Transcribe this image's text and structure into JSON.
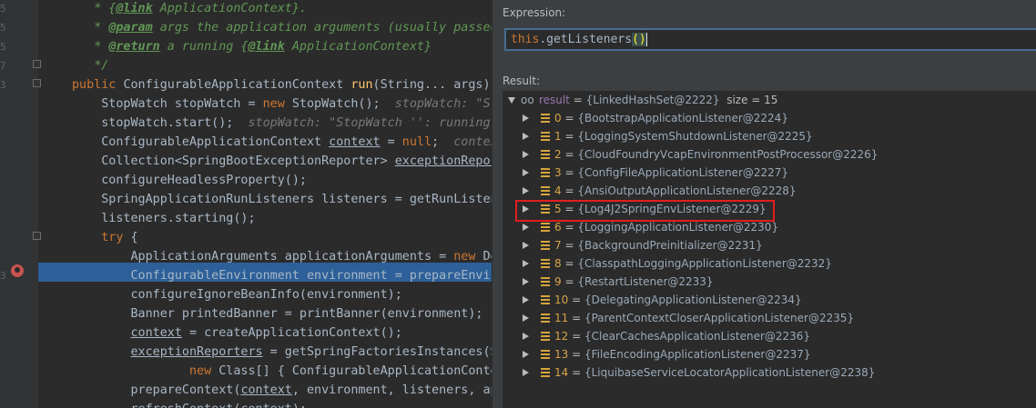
{
  "editor": {
    "line_numbers": [
      "5",
      "5",
      "5",
      "7",
      "3",
      "",
      "",
      "",
      "",
      "",
      "",
      "",
      "",
      "",
      "3",
      "",
      "",
      "",
      "",
      "",
      "",
      ""
    ],
    "lines": [
      {
        "indent": "   ",
        "parts": [
          [
            "cm",
            "* {"
          ],
          [
            "tg",
            "@link"
          ],
          [
            "cm",
            " ApplicationContext}."
          ]
        ]
      },
      {
        "indent": "   ",
        "parts": [
          [
            "cm",
            "* "
          ],
          [
            "tg",
            "@param"
          ],
          [
            "cm",
            " args the application arguments (usually passed f"
          ]
        ]
      },
      {
        "indent": "   ",
        "parts": [
          [
            "cm",
            "* "
          ],
          [
            "tg",
            "@return"
          ],
          [
            "cm",
            " a running {"
          ],
          [
            "tg",
            "@link"
          ],
          [
            "cm",
            " ApplicationContext}"
          ]
        ]
      },
      {
        "indent": "   ",
        "parts": [
          [
            "cm",
            "*/"
          ]
        ]
      },
      {
        "indent": "",
        "parts": [
          [
            "kw",
            "public "
          ],
          [
            "",
            "ConfigurableApplicationContext "
          ],
          [
            "fn",
            "run"
          ],
          [
            "",
            "(String... args) "
          ]
        ]
      },
      {
        "indent": "    ",
        "parts": [
          [
            "",
            "StopWatch stopWatch = "
          ],
          [
            "kw",
            "new "
          ],
          [
            "",
            "StopWatch();  "
          ],
          [
            "hn",
            "stopWatch: \"St"
          ]
        ]
      },
      {
        "indent": "    ",
        "parts": [
          [
            "",
            "stopWatch.start();  "
          ],
          [
            "hn",
            "stopWatch: \"StopWatch '': running"
          ]
        ]
      },
      {
        "indent": "    ",
        "parts": [
          [
            "",
            "ConfigurableApplicationContext "
          ],
          [
            "ul",
            "context"
          ],
          [
            "",
            " = "
          ],
          [
            "kw",
            "null"
          ],
          [
            "",
            ";  "
          ],
          [
            "hn",
            "contex"
          ]
        ]
      },
      {
        "indent": "    ",
        "parts": [
          [
            "",
            "Collection<SpringBootExceptionReporter> "
          ],
          [
            "ul",
            "exceptionRepor"
          ]
        ]
      },
      {
        "indent": "    ",
        "parts": [
          [
            "",
            "configureHeadlessProperty();"
          ]
        ]
      },
      {
        "indent": "    ",
        "parts": [
          [
            "",
            "SpringApplicationRunListeners listeners = getRunListen"
          ]
        ]
      },
      {
        "indent": "    ",
        "parts": [
          [
            "",
            "listeners.starting();"
          ]
        ]
      },
      {
        "indent": "    ",
        "parts": [
          [
            "kw",
            "try "
          ],
          [
            "",
            "{"
          ]
        ]
      },
      {
        "indent": "        ",
        "parts": [
          [
            "",
            "ApplicationArguments applicationArguments = "
          ],
          [
            "kw",
            "new "
          ],
          [
            "",
            "De"
          ]
        ]
      },
      {
        "indent": "        ",
        "parts": [
          [
            "",
            "ConfigurableEnvironment environment = prepareEnvir"
          ]
        ]
      },
      {
        "indent": "        ",
        "parts": [
          [
            "",
            "configureIgnoreBeanInfo(environment);"
          ]
        ]
      },
      {
        "indent": "        ",
        "parts": [
          [
            "",
            "Banner printedBanner = printBanner(environment);"
          ]
        ]
      },
      {
        "indent": "        ",
        "parts": [
          [
            "ul",
            "context"
          ],
          [
            "",
            " = createApplicationContext();"
          ]
        ]
      },
      {
        "indent": "        ",
        "parts": [
          [
            "ul",
            "exceptionReporters"
          ],
          [
            "",
            " = getSpringFactoriesInstances(S"
          ]
        ]
      },
      {
        "indent": "                ",
        "parts": [
          [
            "kw",
            "new "
          ],
          [
            "",
            "Class[] { ConfigurableApplicationConte"
          ]
        ]
      },
      {
        "indent": "        ",
        "parts": [
          [
            "",
            "prepareContext("
          ],
          [
            "ul",
            "context"
          ],
          [
            "",
            ", environment, listeners, ap"
          ]
        ]
      },
      {
        "indent": "        ",
        "parts": [
          [
            "",
            "refreshContext(context);"
          ]
        ]
      }
    ]
  },
  "evaluate": {
    "expression_label": "Expression:",
    "expression_this": "this",
    "expression_rest": ".getListeners",
    "expression_paren_open": "(",
    "expression_paren_close": ")",
    "result_label": "Result:",
    "root": {
      "name": "result",
      "eq": " = ",
      "value": "{LinkedHashSet@2222}",
      "size": "size = 15"
    },
    "items": [
      {
        "index": "0",
        "value": "{BootstrapApplicationListener@2224}"
      },
      {
        "index": "1",
        "value": "{LoggingSystemShutdownListener@2225}"
      },
      {
        "index": "2",
        "value": "{CloudFoundryVcapEnvironmentPostProcessor@2226}"
      },
      {
        "index": "3",
        "value": "{ConfigFileApplicationListener@2227}"
      },
      {
        "index": "4",
        "value": "{AnsiOutputApplicationListener@2228}"
      },
      {
        "index": "5",
        "value": "{Log4J2SpringEnvListener@2229}"
      },
      {
        "index": "6",
        "value": "{LoggingApplicationListener@2230}"
      },
      {
        "index": "7",
        "value": "{BackgroundPreinitializer@2231}"
      },
      {
        "index": "8",
        "value": "{ClasspathLoggingApplicationListener@2232}"
      },
      {
        "index": "9",
        "value": "{RestartListener@2233}"
      },
      {
        "index": "10",
        "value": "{DelegatingApplicationListener@2234}"
      },
      {
        "index": "11",
        "value": "{ParentContextCloserApplicationListener@2235}"
      },
      {
        "index": "12",
        "value": "{ClearCachesApplicationListener@2236}"
      },
      {
        "index": "13",
        "value": "{FileEncodingApplicationListener@2237}"
      },
      {
        "index": "14",
        "value": "{LiquibaseServiceLocatorApplicationListener@2238}"
      }
    ],
    "highlighted_index": 5
  },
  "colors": {
    "selection": "#2d6099",
    "highlight_box": "#e21e1e",
    "panel_bg": "#3c3f41"
  }
}
